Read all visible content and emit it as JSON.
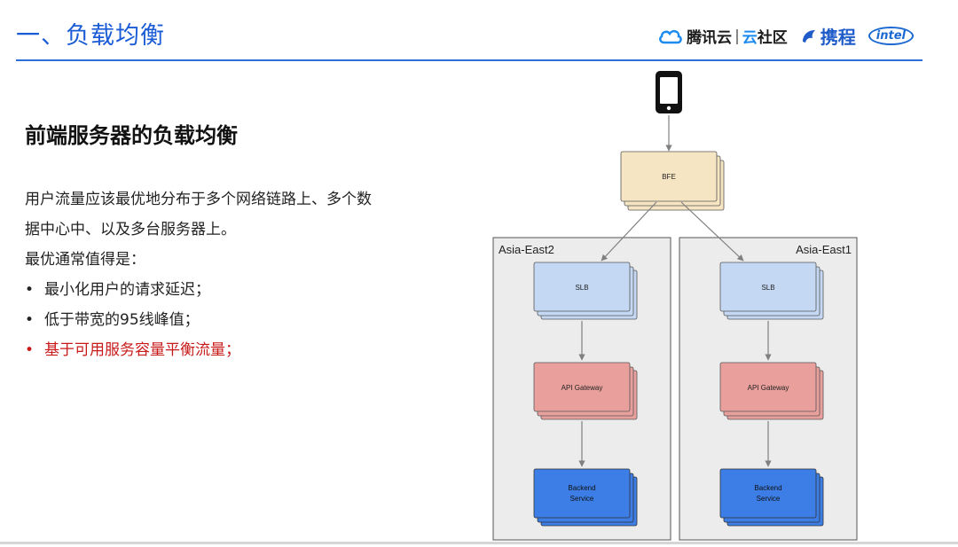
{
  "header": {
    "title": "一、负载均衡",
    "logos": {
      "tencent_cloud": "腾讯云",
      "separator": "|",
      "community_prefix": "云",
      "community_suffix": "社区",
      "ctrip": "携程",
      "intel": "intel"
    }
  },
  "content": {
    "subtitle": "前端服务器的负载均衡",
    "paragraph_1": "用户流量应该最优地分布于多个网络链路上、多个数",
    "paragraph_2": "据中心中、以及多台服务器上。",
    "paragraph_3": "最优通常值得是：",
    "bullets": [
      {
        "text": "最小化用户的请求延迟；"
      },
      {
        "text": "低于带宽的95线峰值；"
      },
      {
        "text": "基于可用服务容量平衡流量；",
        "color": "#c91a1a"
      }
    ]
  },
  "diagram": {
    "bfe_label": "BFE",
    "regions": [
      {
        "name": "Asia-East2",
        "slb": "SLB",
        "gateway": "API Gateway",
        "backend_line1": "Backend",
        "backend_line2": "Service"
      },
      {
        "name": "Asia-East1",
        "slb": "SLB",
        "gateway": "API Gateway",
        "backend_line1": "Backend",
        "backend_line2": "Service"
      }
    ],
    "colors": {
      "bfe": "#f6e5c2",
      "slb": "#c4d8f4",
      "gateway": "#e9a09c",
      "backend": "#3c7de6",
      "region_bg": "#ececec"
    }
  }
}
